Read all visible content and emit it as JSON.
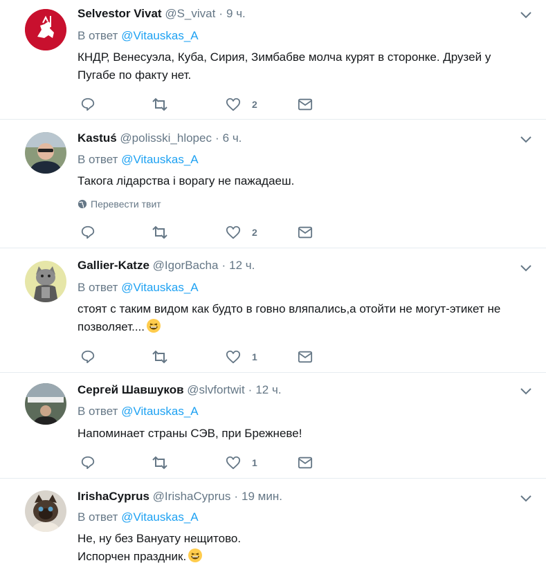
{
  "tweets": [
    {
      "name": "Selvestor Vivat",
      "handle": "@S_vivat",
      "time": "9 ч.",
      "reply_prefix": "В ответ",
      "reply_to": "@Vitauskas_A",
      "text": [
        "КНДР, Венесуэла, Куба, Сирия, Зимбабве молча курят в сторонке. Друзей у",
        "Пугабе по факту нет."
      ],
      "likes": "2",
      "translate": ""
    },
    {
      "name": "Kastuś",
      "handle": "@polisski_hlopec",
      "time": "6 ч.",
      "reply_prefix": "В ответ",
      "reply_to": "@Vitauskas_A",
      "text": [
        "Такога лідарства і ворагу не пажадаеш."
      ],
      "likes": "2",
      "translate": "Перевести твит"
    },
    {
      "name": "Gallier-Katze",
      "handle": "@IgorBacha",
      "time": "12 ч.",
      "reply_prefix": "В ответ",
      "reply_to": "@Vitauskas_A",
      "text": [
        "стоят с таким видом как будто в говно вляпались,а отойти не могут-этикет не",
        "позволяет...."
      ],
      "likes": "1",
      "translate": ""
    },
    {
      "name": "Сергей Шавшуков",
      "handle": "@slvfortwit",
      "time": "12 ч.",
      "reply_prefix": "В ответ",
      "reply_to": "@Vitauskas_A",
      "text": [
        "Напоминает страны СЭВ, при Брежневе!"
      ],
      "likes": "1",
      "translate": ""
    },
    {
      "name": "IrishaCyprus",
      "handle": "@IrishaCyprus",
      "time": "19 мин.",
      "reply_prefix": "В ответ",
      "reply_to": "@Vitauskas_A",
      "text": [
        "Не, ну без Вануату нещитово.",
        "Испорчен праздник."
      ],
      "likes": "",
      "translate": ""
    }
  ],
  "colors": {
    "link": "#1da1f2",
    "muted": "#657786",
    "border": "#e6ecf0"
  }
}
